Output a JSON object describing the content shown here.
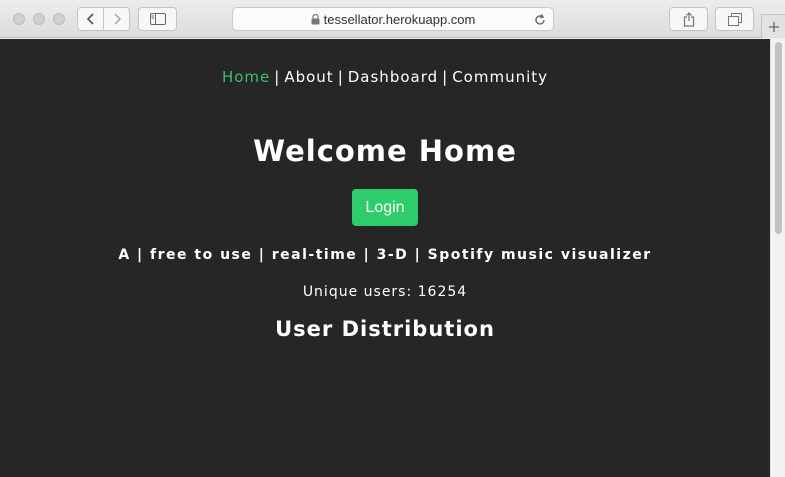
{
  "browser": {
    "url": "tessellator.herokuapp.com",
    "icons": [
      "back-icon",
      "forward-icon",
      "sidebar-icon",
      "lock-icon",
      "reload-icon",
      "share-icon",
      "tabs-icon",
      "plus-icon"
    ]
  },
  "nav": {
    "home": "Home",
    "about": "About",
    "dashboard": "Dashboard",
    "community": "Community",
    "separator": "|",
    "active_color": "#3dbd7a"
  },
  "main": {
    "title": "Welcome Home",
    "login_label": "Login",
    "tagline": "A | free to use | real-time | 3-D | Spotify music visualizer",
    "users_label": "Unique users: 16254",
    "distribution_title": "User Distribution"
  },
  "colors": {
    "background": "#262626",
    "login_button": "#2fcc6b"
  }
}
